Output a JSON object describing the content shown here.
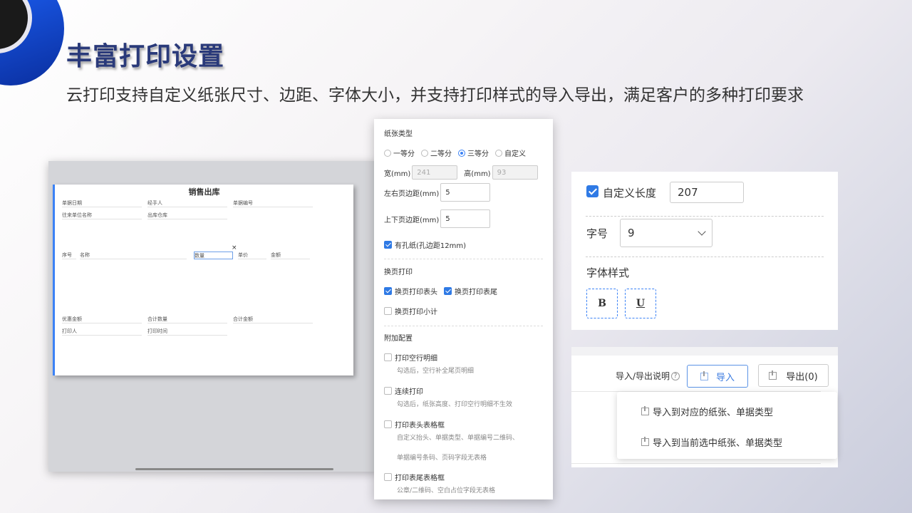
{
  "slide": {
    "title": "丰富打印设置",
    "subtitle": "云打印支持自定义纸张尺寸、边距、字体大小，并支持打印样式的导入导出，满足客户的多种打印要求"
  },
  "preview": {
    "sheet_title": "销售出库",
    "row1": [
      "单据日期",
      "经手人",
      "单据编号"
    ],
    "row2": [
      "往来单位名称",
      "出库仓库"
    ],
    "table_headers": [
      "序号",
      "名称",
      "数量",
      "单价",
      "金额"
    ],
    "footer1": [
      "优惠金额",
      "合计数量",
      "合计金额"
    ],
    "footer2": [
      "打印人",
      "打印时间"
    ]
  },
  "settings": {
    "paper_type_label": "纸张类型",
    "paper_options": [
      "一等分",
      "二等分",
      "三等分",
      "自定义"
    ],
    "paper_selected": "三等分",
    "width_label": "宽(mm)",
    "width_value": "241",
    "height_label": "高(mm)",
    "height_value": "93",
    "lr_margin_label": "左右页边距(mm)",
    "lr_margin_value": "5",
    "tb_margin_label": "上下页边距(mm)",
    "tb_margin_value": "5",
    "hole_paper_label": "有孔纸(孔边距12mm)",
    "page_break_label": "换页打印",
    "pb_header_label": "换页打印表头",
    "pb_footer_label": "换页打印表尾",
    "pb_subtotal_label": "换页打印小计",
    "extra_label": "附加配置",
    "empty_rows_label": "打印空行明细",
    "empty_rows_hint": "勾选后，空行补全尾页明细",
    "continuous_label": "连续打印",
    "continuous_hint": "勾选后，纸张高度、打印空行明细不生效",
    "header_grid_label": "打印表头表格框",
    "header_grid_hint1": "自定义抬头、单据类型、单据编号二维码、",
    "header_grid_hint2": "单据编号条码、页码字段无表格",
    "footer_grid_label": "打印表尾表格框",
    "footer_grid_hint": "公章/二维码、空白占位字段无表格"
  },
  "font": {
    "custom_length_label": "自定义长度",
    "custom_length_value": "207",
    "size_label": "字号",
    "size_value": "9",
    "style_label": "字体样式",
    "bold": "B",
    "underline": "U"
  },
  "import_export": {
    "help_label": "导入/导出说明",
    "help_mark": "?",
    "import_label": "导入",
    "export_label": "导出(0)",
    "menu": [
      "导入到对应的纸张、单据类型",
      "导入到当前选中纸张、单据类型"
    ]
  }
}
